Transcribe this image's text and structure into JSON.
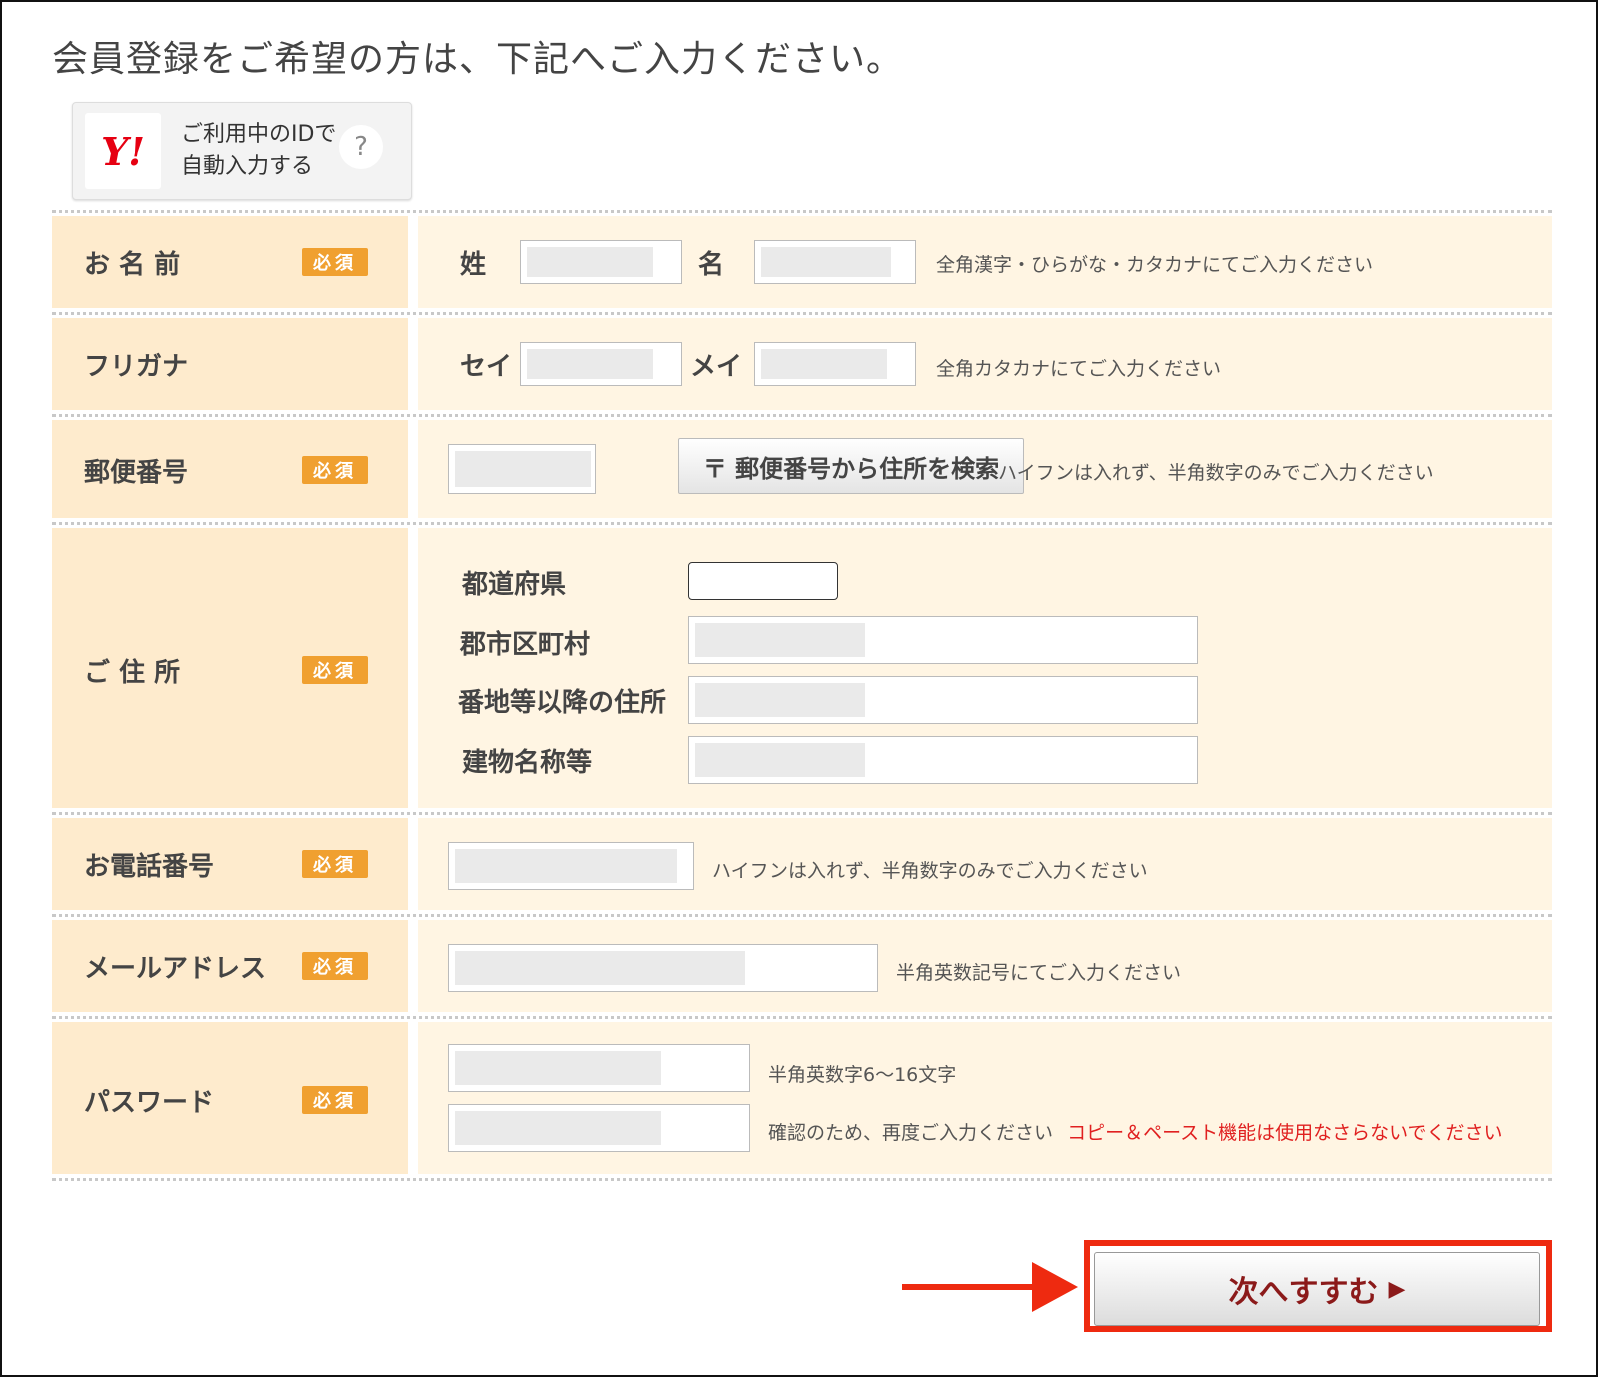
{
  "heading": "会員登録をご希望の方は、下記へご入力ください。",
  "yahoo": {
    "logo": "Y!",
    "line1": "ご利用中のIDで",
    "line2": "自動入力する",
    "help": "?"
  },
  "required_badge": "必須",
  "rows": {
    "name": {
      "label": "お 名 前",
      "last_label": "姓",
      "first_label": "名",
      "hint": "全角漢字・ひらがな・カタカナにてご入力ください"
    },
    "furigana": {
      "label": "フリガナ",
      "last_label": "セイ",
      "first_label": "メイ",
      "hint": "全角カタカナにてご入力ください"
    },
    "zip": {
      "label": "郵便番号",
      "button": "〒 郵便番号から住所を検索",
      "hint": "ハイフンは入れず、半角数字のみでご入力ください"
    },
    "address": {
      "label": "ご 住 所",
      "prefecture": "都道府県",
      "city": "郡市区町村",
      "street": "番地等以降の住所",
      "building": "建物名称等"
    },
    "phone": {
      "label": "お電話番号",
      "hint": "ハイフンは入れず、半角数字のみでご入力ください"
    },
    "email": {
      "label": "メールアドレス",
      "hint": "半角英数記号にてご入力ください"
    },
    "password": {
      "label": "パスワード",
      "hint1": "半角英数字6〜16文字",
      "hint2": "確認のため、再度ご入力ください",
      "warning": "コピー＆ペースト機能は使用なさらないでください"
    }
  },
  "next_button": "次へすすむ",
  "next_arrow": "▶",
  "colors": {
    "label_bg": "#feebcd",
    "value_bg": "#fff5e3",
    "required_badge": "#f0a030",
    "highlight": "#ee2a10",
    "warning": "#e02020"
  }
}
